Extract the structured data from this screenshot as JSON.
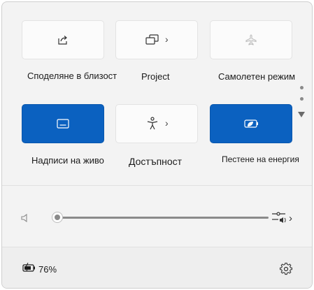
{
  "tiles": [
    {
      "label": "Споделяне в близост",
      "icon": "share-icon",
      "state": "off"
    },
    {
      "label": "Project",
      "icon": "project-icon",
      "state": "off",
      "has_chevron": true
    },
    {
      "label": "Самолетен режим",
      "icon": "airplane-icon",
      "state": "disabled"
    },
    {
      "label": "Надписи на живо",
      "icon": "live-captions-icon",
      "state": "on"
    },
    {
      "label": "Достъпност",
      "icon": "accessibility-icon",
      "state": "off",
      "has_chevron": true
    },
    {
      "label": "Пестене на енергия",
      "icon": "energy-saver-icon",
      "state": "on"
    }
  ],
  "chevron": "›",
  "volume": {
    "level": 0,
    "icon": "speaker-icon",
    "output_icon": "audio-output-icon"
  },
  "battery": {
    "percent": "76%",
    "icon": "battery-charging-icon"
  },
  "settings_icon": "gear-icon",
  "colors": {
    "accent": "#0b61c0",
    "panel": "#f3f3f3",
    "tile": "#fbfbfb"
  }
}
